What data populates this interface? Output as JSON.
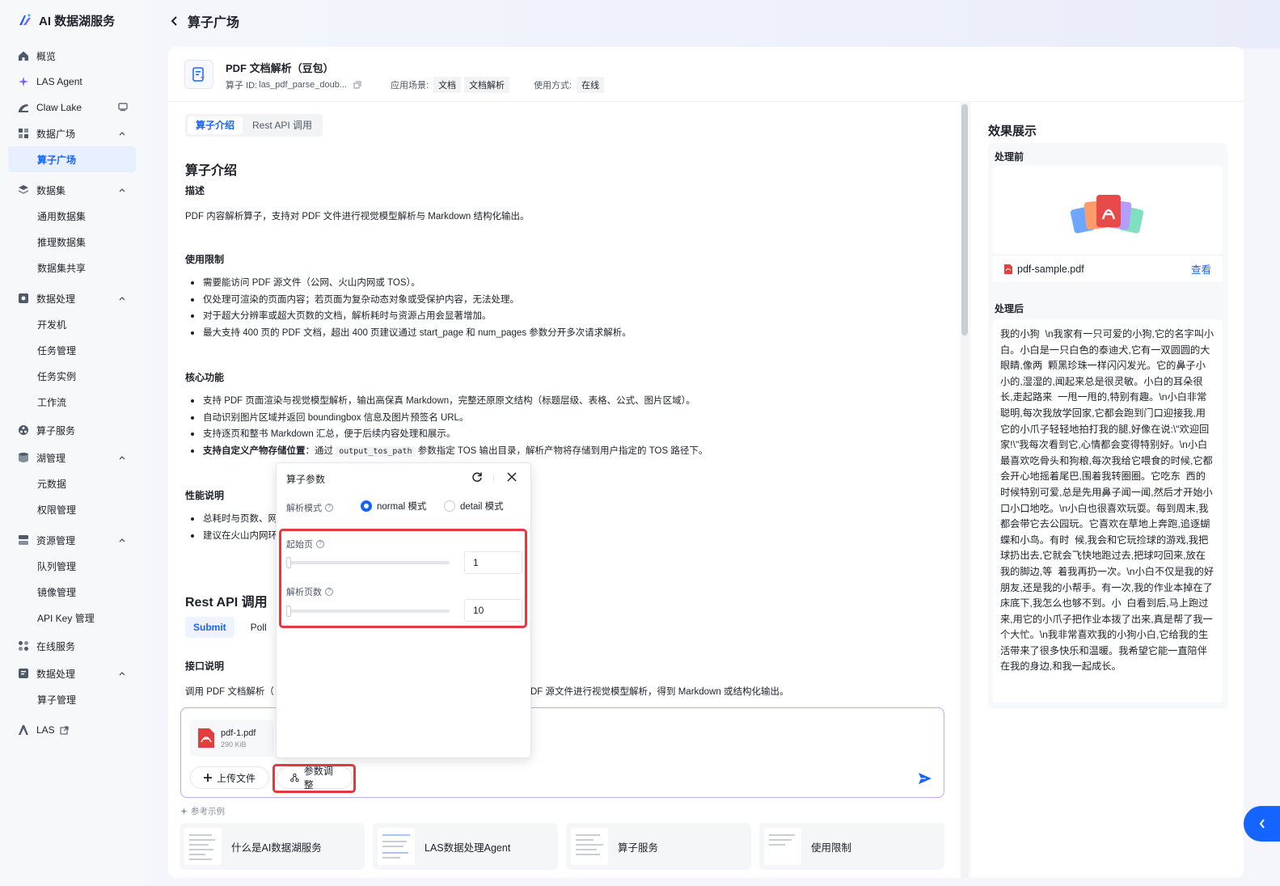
{
  "app": {
    "name": "AI 数据湖服务"
  },
  "colors": {
    "accent": "#1664ff",
    "highlight": "#e0393e",
    "pdf_red": "#e33d3d"
  },
  "sidebar": {
    "items": [
      {
        "label": "概览",
        "icon": "home-icon"
      },
      {
        "label": "LAS Agent",
        "icon": "sparkle-icon"
      },
      {
        "label": "Claw Lake",
        "icon": "claw-icon",
        "trail_icon": "monitor-icon"
      },
      {
        "label": "数据广场",
        "icon": "grid-icon",
        "expanded": true,
        "children": [
          {
            "label": "算子广场",
            "active": true
          }
        ]
      },
      {
        "label": "数据集",
        "icon": "layers-icon",
        "expanded": true,
        "children": [
          {
            "label": "通用数据集"
          },
          {
            "label": "推理数据集"
          },
          {
            "label": "数据集共享"
          }
        ]
      },
      {
        "label": "数据处理",
        "icon": "process-icon",
        "expanded": true,
        "children": [
          {
            "label": "开发机"
          },
          {
            "label": "任务管理"
          },
          {
            "label": "任务实例"
          },
          {
            "label": "工作流"
          }
        ]
      },
      {
        "label": "算子服务",
        "icon": "nodes-icon"
      },
      {
        "label": "湖管理",
        "icon": "database-icon",
        "expanded": true,
        "children": [
          {
            "label": "元数据"
          },
          {
            "label": "权限管理"
          }
        ]
      },
      {
        "label": "资源管理",
        "icon": "server-icon",
        "expanded": true,
        "children": [
          {
            "label": "队列管理"
          },
          {
            "label": "镜像管理"
          },
          {
            "label": "API Key 管理"
          }
        ]
      },
      {
        "label": "在线服务",
        "icon": "apps-icon"
      },
      {
        "label": "数据处理",
        "icon": "process-icon",
        "expanded": true,
        "children": [
          {
            "label": "算子管理"
          }
        ]
      },
      {
        "label": "LAS",
        "icon": "las-logo-icon",
        "trail_icon": "external-link-icon"
      }
    ]
  },
  "header": {
    "title": "算子广场"
  },
  "operator": {
    "title": "PDF 文档解析（豆包）",
    "id_label": "算子 ID:",
    "id_value": "las_pdf_parse_doub...",
    "scene_label": "应用场景:",
    "scene_tags": [
      "文档",
      "文档解析"
    ],
    "usage_label": "使用方式:",
    "usage_tags": [
      "在线"
    ]
  },
  "tabs": [
    {
      "label": "算子介绍",
      "active": true
    },
    {
      "label": "Rest API 调用",
      "active": false
    }
  ],
  "intro": {
    "title": "算子介绍",
    "desc_title": "描述",
    "desc": "PDF 内容解析算子，支持对 PDF 文件进行视觉模型解析与 Markdown 结构化输出。",
    "limits_title": "使用限制",
    "limits": [
      "需要能访问 PDF 源文件（公网、火山内网或 TOS）。",
      "仅处理可渲染的页面内容；若页面为复杂动态对象或受保护内容，无法处理。",
      "对于超大分辨率或超大页数的文档，解析耗时与资源占用会显著增加。",
      "最大支持 400 页的 PDF 文档，超出 400 页建议通过 start_page 和 num_pages 参数分开多次请求解析。"
    ],
    "features_title": "核心功能",
    "features": [
      "支持 PDF 页面渲染与视觉模型解析，输出高保真 Markdown，完整还原原文结构（标题层级、表格、公式、图片区域）。",
      "自动识别图片区域并返回 boundingbox 信息及图片预签名 URL。",
      "支持逐页和整书 Markdown 汇总，便于后续内容处理和展示。"
    ],
    "feature_custom_bold": "支持自定义产物存储位置",
    "feature_custom_pre": "：通过",
    "feature_custom_code": "output_tos_path",
    "feature_custom_post": "参数指定 TOS 输出目录，解析产物将存储到用户指定的 TOS 路径下。",
    "perf_title": "性能说明",
    "perf": [
      "总耗时与页数、网",
      "建议在火山内网环"
    ]
  },
  "rest": {
    "title": "Rest API 调用",
    "subtabs": [
      {
        "label": "Submit",
        "active": true
      },
      {
        "label": "Poll",
        "active": false
      }
    ],
    "api_title": "接口说明",
    "api_desc_left": "调用 PDF 文档解析（",
    "api_desc_right": "DF 源文件进行视觉模型解析，得到 Markdown 或结构化输出。"
  },
  "chat": {
    "file": {
      "name": "pdf-1.pdf",
      "size": "290 KiB"
    },
    "upload_label": "上传文件",
    "params_label": "参数调整",
    "examples_label": "参考示例",
    "examples": [
      "什么是AI数据湖服务",
      "LAS数据处理Agent",
      "算子服务",
      "使用限制"
    ]
  },
  "popover": {
    "title": "算子参数",
    "mode_label": "解析模式",
    "modes": [
      {
        "label": "normal 模式",
        "checked": true
      },
      {
        "label": "detail 模式",
        "checked": false
      }
    ],
    "start_page_label": "起始页",
    "start_page_value": "1",
    "num_pages_label": "解析页数",
    "num_pages_value": "10"
  },
  "showcase": {
    "title": "效果展示",
    "before_label": "处理前",
    "file_name": "pdf-sample.pdf",
    "view_label": "查看",
    "after_label": "处理后",
    "result": "我的小狗  \\n我家有一只可爱的小狗,它的名字叫小白。小白是一只白色的泰迪犬,它有一双圆圆的大眼睛,像两  颗黑珍珠一样闪闪发光。它的鼻子小小的,湿湿的,闻起来总是很灵敏。小白的耳朵很长,走起路来  一甩一甩的,特别有趣。\\n小白非常聪明,每次我放学回家,它都会跑到门口迎接我,用它的小爪子轻轻地拍打我的腿,好像在说:\\\"欢迎回家!\\\"我每次看到它,心情都会变得特别好。\\n小白最喜欢吃骨头和狗粮,每次我给它喂食的时候,它都会开心地摇着尾巴,围着我转圈圈。它吃东  西的时候特别可爱,总是先用鼻子闻一闻,然后才开始小口小口地吃。\\n小白也很喜欢玩耍。每到周末,我都会带它去公园玩。它喜欢在草地上奔跑,追逐蝴蝶和小鸟。有时  候,我会和它玩捡球的游戏,我把球扔出去,它就会飞快地跑过去,把球叼回来,放在我的脚边,等  着我再扔一次。\\n小白不仅是我的好朋友,还是我的小帮手。有一次,我的作业本掉在了床底下,我怎么也够不到。小  白看到后,马上跑过来,用它的小爪子把作业本拨了出来,真是帮了我一个大忙。\\n我非常喜欢我的小狗小白,它给我的生活带来了很多快乐和温暖。我希望它能一直陪伴在我的身边,和我一起成长。"
  }
}
